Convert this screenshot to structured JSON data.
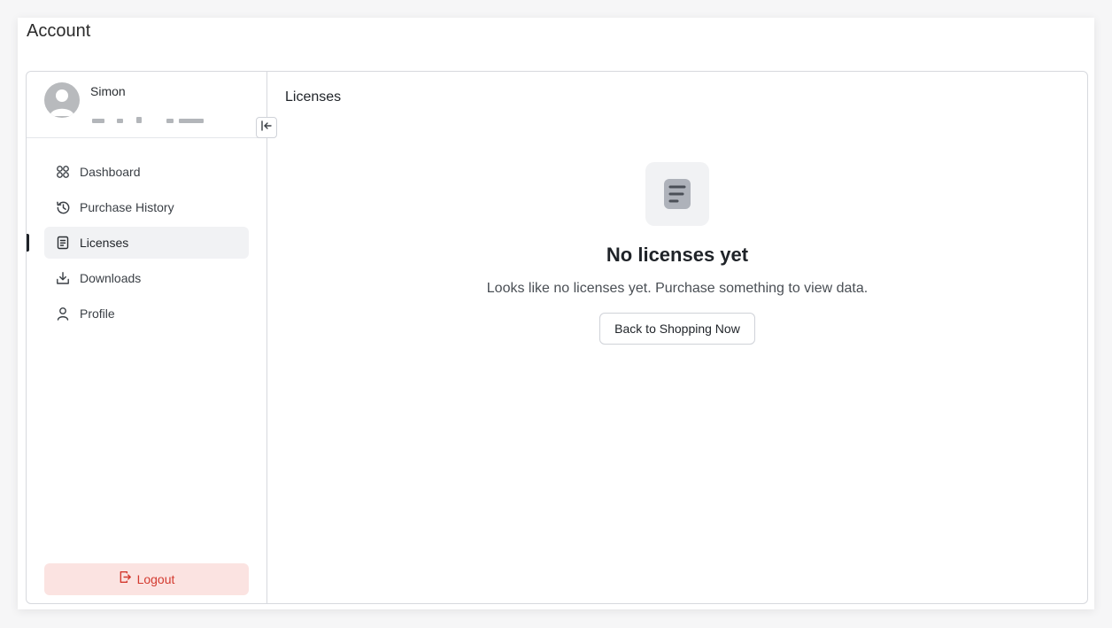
{
  "page": {
    "title": "Account"
  },
  "user": {
    "name": "Simon"
  },
  "sidebar": {
    "collapse_icon": "collapse-left-icon",
    "items": [
      {
        "label": "Dashboard",
        "icon": "dashboard-icon",
        "active": false
      },
      {
        "label": "Purchase History",
        "icon": "history-icon",
        "active": false
      },
      {
        "label": "Licenses",
        "icon": "license-icon",
        "active": true
      },
      {
        "label": "Downloads",
        "icon": "download-icon",
        "active": false
      },
      {
        "label": "Profile",
        "icon": "user-icon",
        "active": false
      }
    ],
    "logout_label": "Logout"
  },
  "content": {
    "title": "Licenses",
    "empty_state": {
      "icon": "document-icon",
      "title": "No licenses yet",
      "message": "Looks like no licenses yet. Purchase something to view data.",
      "button_label": "Back to Shopping Now"
    }
  },
  "colors": {
    "accent_dark": "#1f2328",
    "logout_bg": "#fbe3e1",
    "logout_text": "#d33a2f",
    "active_bg": "#f1f2f4"
  }
}
